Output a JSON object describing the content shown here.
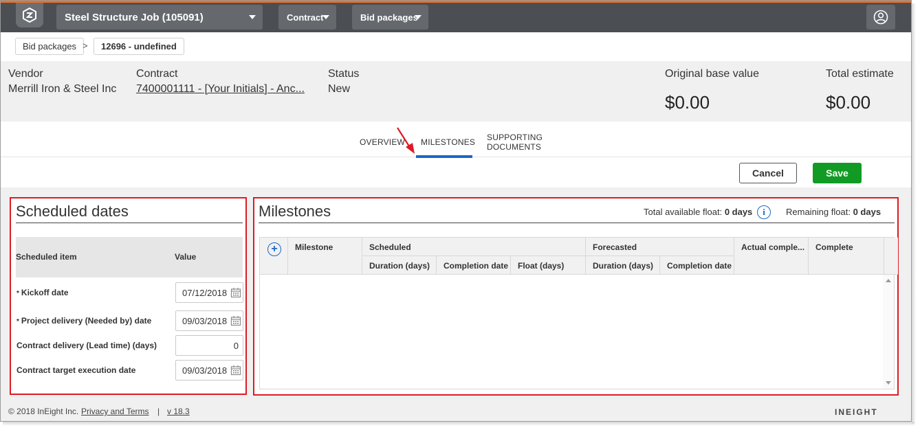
{
  "topbar": {
    "job_label": "Steel Structure Job (105091)",
    "contract_label": "Contract",
    "bid_packages_label": "Bid packages",
    "accent_color": "#e8702a"
  },
  "breadcrumb": {
    "items": [
      "Bid packages",
      "12696 - undefined"
    ],
    "separator": ">"
  },
  "header": {
    "vendor_label": "Vendor",
    "vendor_value": "Merrill Iron & Steel Inc",
    "contract_label": "Contract",
    "contract_value": "7400001111 - [Your Initials] - Anc...",
    "status_label": "Status",
    "status_value": "New",
    "original_base_label": "Original base value",
    "original_base_value": "$0.00",
    "total_estimate_label": "Total estimate",
    "total_estimate_value": "$0.00"
  },
  "tabs": [
    {
      "label": "OVERVIEW",
      "active": false
    },
    {
      "label": "MILESTONES",
      "active": true
    },
    {
      "label": "SUPPORTING",
      "label2": "DOCUMENTS",
      "active": false
    }
  ],
  "actions": {
    "cancel_label": "Cancel",
    "save_label": "Save",
    "save_color": "#129b24"
  },
  "scheduled_dates": {
    "title": "Scheduled dates",
    "col_item": "Scheduled item",
    "col_value": "Value",
    "rows": [
      {
        "label": "Kickoff date",
        "required": true,
        "value": "07/12/2018",
        "type": "date"
      },
      {
        "label": "Project delivery (Needed by) date",
        "required": true,
        "value": "09/03/2018",
        "type": "date"
      },
      {
        "label": "Contract delivery (Lead time) (days)",
        "required": false,
        "value": "0",
        "type": "number"
      },
      {
        "label": "Contract target execution date",
        "required": false,
        "value": "09/03/2018",
        "type": "date"
      }
    ],
    "required_mark": "*"
  },
  "milestones": {
    "title": "Milestones",
    "total_float_label": "Total available float:",
    "total_float_value": "0 days",
    "remaining_float_label": "Remaining float:",
    "remaining_float_value": "0 days",
    "add_symbol": "+",
    "columns": {
      "milestone": "Milestone",
      "scheduled": "Scheduled",
      "forecasted": "Forecasted",
      "actual_complete": "Actual comple...",
      "complete": "Complete",
      "sched_duration": "Duration (days)",
      "sched_completion": "Completion date",
      "sched_float": "Float (days)",
      "fc_duration": "Duration (days)",
      "fc_completion": "Completion date"
    }
  },
  "footer": {
    "copyright": "© 2018 InEight Inc.",
    "privacy_link": "Privacy and Terms",
    "separator": "|",
    "version": "v 18.3",
    "brand": "INEIGHT"
  },
  "highlight_color": "#dd1a22",
  "tab_active_color": "#1b67c2"
}
